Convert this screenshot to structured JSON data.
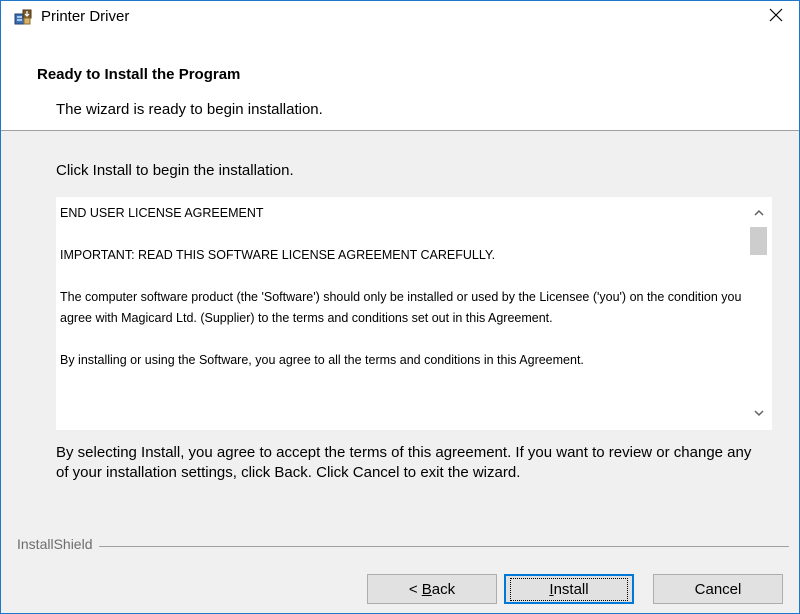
{
  "window": {
    "title": "Printer Driver",
    "app_icon": "installer-icon",
    "close_icon": "close-icon"
  },
  "header": {
    "title": "Ready to Install the Program",
    "subtitle": "The wizard is ready to begin installation."
  },
  "body": {
    "instruction": "Click Install to begin the installation.",
    "license_paragraphs": [
      "END USER LICENSE AGREEMENT",
      "IMPORTANT: READ THIS SOFTWARE LICENSE AGREEMENT CAREFULLY.",
      "The computer software product (the 'Software') should only be installed or used by the Licensee ('you') on the condition you agree with Magicard Ltd. (Supplier) to the terms and conditions set out in this Agreement.",
      "By installing or using the Software, you agree to all the terms and conditions in this Agreement."
    ],
    "agreement_note": "By selecting Install, you agree to accept the terms of this agreement. If you want to review or change any of your installation settings, click Back. Click Cancel to exit the wizard."
  },
  "footer": {
    "brand": "InstallShield",
    "back_prefix": "< ",
    "back_accel": "B",
    "back_rest": "ack",
    "install_accel": "I",
    "install_rest": "nstall",
    "cancel_label": "Cancel"
  },
  "colors": {
    "window_border": "#1f77c9",
    "default_button_border": "#0078d7",
    "dialog_background": "#f0f0f0"
  }
}
